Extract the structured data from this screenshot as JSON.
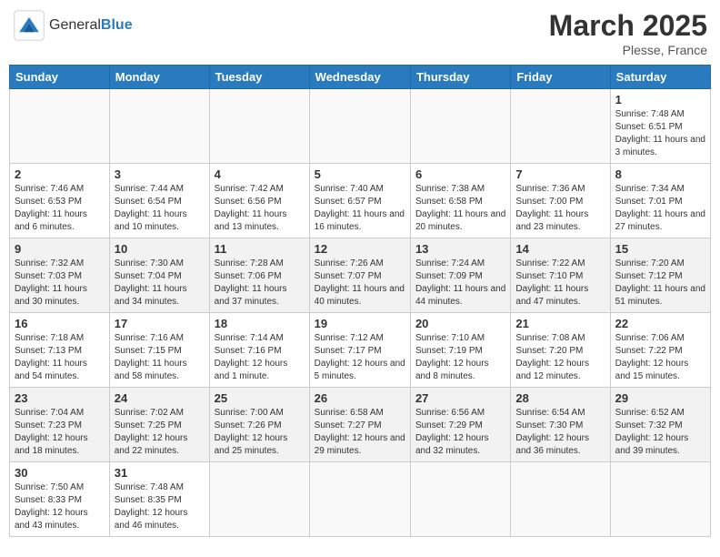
{
  "header": {
    "logo_general": "General",
    "logo_blue": "Blue",
    "month_title": "March 2025",
    "location": "Plesse, France"
  },
  "weekdays": [
    "Sunday",
    "Monday",
    "Tuesday",
    "Wednesday",
    "Thursday",
    "Friday",
    "Saturday"
  ],
  "days": {
    "d1": {
      "number": "1",
      "info": "Sunrise: 7:48 AM\nSunset: 6:51 PM\nDaylight: 11 hours and 3 minutes."
    },
    "d2": {
      "number": "2",
      "info": "Sunrise: 7:46 AM\nSunset: 6:53 PM\nDaylight: 11 hours and 6 minutes."
    },
    "d3": {
      "number": "3",
      "info": "Sunrise: 7:44 AM\nSunset: 6:54 PM\nDaylight: 11 hours and 10 minutes."
    },
    "d4": {
      "number": "4",
      "info": "Sunrise: 7:42 AM\nSunset: 6:56 PM\nDaylight: 11 hours and 13 minutes."
    },
    "d5": {
      "number": "5",
      "info": "Sunrise: 7:40 AM\nSunset: 6:57 PM\nDaylight: 11 hours and 16 minutes."
    },
    "d6": {
      "number": "6",
      "info": "Sunrise: 7:38 AM\nSunset: 6:58 PM\nDaylight: 11 hours and 20 minutes."
    },
    "d7": {
      "number": "7",
      "info": "Sunrise: 7:36 AM\nSunset: 7:00 PM\nDaylight: 11 hours and 23 minutes."
    },
    "d8": {
      "number": "8",
      "info": "Sunrise: 7:34 AM\nSunset: 7:01 PM\nDaylight: 11 hours and 27 minutes."
    },
    "d9": {
      "number": "9",
      "info": "Sunrise: 7:32 AM\nSunset: 7:03 PM\nDaylight: 11 hours and 30 minutes."
    },
    "d10": {
      "number": "10",
      "info": "Sunrise: 7:30 AM\nSunset: 7:04 PM\nDaylight: 11 hours and 34 minutes."
    },
    "d11": {
      "number": "11",
      "info": "Sunrise: 7:28 AM\nSunset: 7:06 PM\nDaylight: 11 hours and 37 minutes."
    },
    "d12": {
      "number": "12",
      "info": "Sunrise: 7:26 AM\nSunset: 7:07 PM\nDaylight: 11 hours and 40 minutes."
    },
    "d13": {
      "number": "13",
      "info": "Sunrise: 7:24 AM\nSunset: 7:09 PM\nDaylight: 11 hours and 44 minutes."
    },
    "d14": {
      "number": "14",
      "info": "Sunrise: 7:22 AM\nSunset: 7:10 PM\nDaylight: 11 hours and 47 minutes."
    },
    "d15": {
      "number": "15",
      "info": "Sunrise: 7:20 AM\nSunset: 7:12 PM\nDaylight: 11 hours and 51 minutes."
    },
    "d16": {
      "number": "16",
      "info": "Sunrise: 7:18 AM\nSunset: 7:13 PM\nDaylight: 11 hours and 54 minutes."
    },
    "d17": {
      "number": "17",
      "info": "Sunrise: 7:16 AM\nSunset: 7:15 PM\nDaylight: 11 hours and 58 minutes."
    },
    "d18": {
      "number": "18",
      "info": "Sunrise: 7:14 AM\nSunset: 7:16 PM\nDaylight: 12 hours and 1 minute."
    },
    "d19": {
      "number": "19",
      "info": "Sunrise: 7:12 AM\nSunset: 7:17 PM\nDaylight: 12 hours and 5 minutes."
    },
    "d20": {
      "number": "20",
      "info": "Sunrise: 7:10 AM\nSunset: 7:19 PM\nDaylight: 12 hours and 8 minutes."
    },
    "d21": {
      "number": "21",
      "info": "Sunrise: 7:08 AM\nSunset: 7:20 PM\nDaylight: 12 hours and 12 minutes."
    },
    "d22": {
      "number": "22",
      "info": "Sunrise: 7:06 AM\nSunset: 7:22 PM\nDaylight: 12 hours and 15 minutes."
    },
    "d23": {
      "number": "23",
      "info": "Sunrise: 7:04 AM\nSunset: 7:23 PM\nDaylight: 12 hours and 18 minutes."
    },
    "d24": {
      "number": "24",
      "info": "Sunrise: 7:02 AM\nSunset: 7:25 PM\nDaylight: 12 hours and 22 minutes."
    },
    "d25": {
      "number": "25",
      "info": "Sunrise: 7:00 AM\nSunset: 7:26 PM\nDaylight: 12 hours and 25 minutes."
    },
    "d26": {
      "number": "26",
      "info": "Sunrise: 6:58 AM\nSunset: 7:27 PM\nDaylight: 12 hours and 29 minutes."
    },
    "d27": {
      "number": "27",
      "info": "Sunrise: 6:56 AM\nSunset: 7:29 PM\nDaylight: 12 hours and 32 minutes."
    },
    "d28": {
      "number": "28",
      "info": "Sunrise: 6:54 AM\nSunset: 7:30 PM\nDaylight: 12 hours and 36 minutes."
    },
    "d29": {
      "number": "29",
      "info": "Sunrise: 6:52 AM\nSunset: 7:32 PM\nDaylight: 12 hours and 39 minutes."
    },
    "d30": {
      "number": "30",
      "info": "Sunrise: 7:50 AM\nSunset: 8:33 PM\nDaylight: 12 hours and 43 minutes."
    },
    "d31": {
      "number": "31",
      "info": "Sunrise: 7:48 AM\nSunset: 8:35 PM\nDaylight: 12 hours and 46 minutes."
    }
  }
}
